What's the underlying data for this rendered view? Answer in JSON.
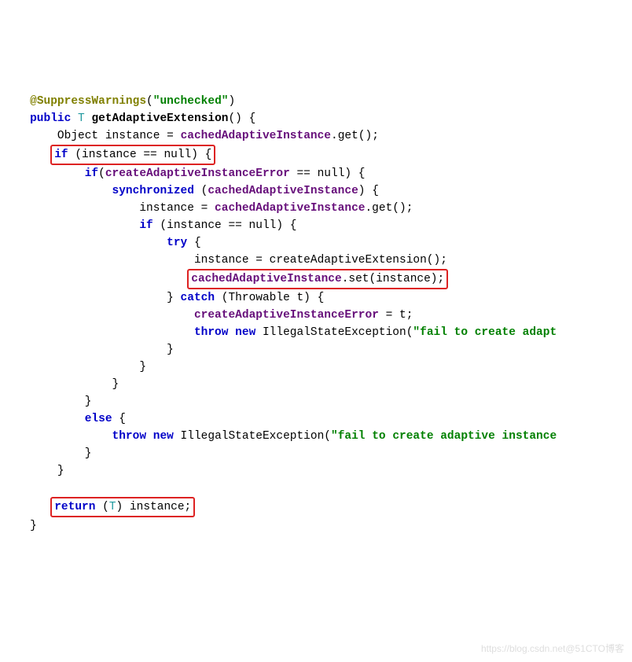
{
  "code": {
    "ann_at": "@",
    "ann_name": "SuppressWarnings",
    "ann_paren_open": "(",
    "ann_str": "\"unchecked\"",
    "ann_paren_close": ")",
    "kw_public": "public",
    "type_T": "T",
    "method_name": "getAdaptiveExtension",
    "paren_pair": "()",
    "brace_open": " {",
    "l1_obj": "Object",
    "l1_inst": " instance = ",
    "l1_field": "cachedAdaptiveInstance",
    "l1_tail": ".get();",
    "box1_if": "if",
    "box1_rest": " (instance == null) {",
    "l3_if": "if",
    "l3_paren": "(",
    "l3_field": "createAdaptiveInstanceError",
    "l3_tail": " == null) {",
    "l4_sync": "synchronized",
    "l4_open": " (",
    "l4_field": "cachedAdaptiveInstance",
    "l4_close": ") {",
    "l5_text": "instance = ",
    "l5_field": "cachedAdaptiveInstance",
    "l5_tail": ".get();",
    "l6_if": "if",
    "l6_rest": " (instance == null) {",
    "l7_try": "try",
    "l7_brace": " {",
    "l8": "instance = createAdaptiveExtension();",
    "box2_field": "cachedAdaptiveInstance",
    "box2_tail": ".set(instance);",
    "l9_close": "}",
    "l9_catch": " catch",
    "l9_rest": " (Throwable t) {",
    "l10_field": "createAdaptiveInstanceError",
    "l10_tail": " = t;",
    "l11_throw": "throw new",
    "l11_exc": " IllegalStateException(",
    "l11_str": "\"fail to create adapt",
    "cb1": "}",
    "cb2": "}",
    "cb3": "}",
    "cb4": "}",
    "else_kw": "else",
    "else_brace": " {",
    "l_else_throw": "throw new",
    "l_else_exc": " IllegalStateException(",
    "l_else_str": "\"fail to create adaptive instance",
    "cb5": "}",
    "cb6": "}",
    "box3_return": "return",
    "box3_open": " (",
    "box3_T": "T",
    "box3_rest": ") instance;",
    "cb_end": "}"
  },
  "watermark": "https://blog.csdn.net@51CTO博客"
}
